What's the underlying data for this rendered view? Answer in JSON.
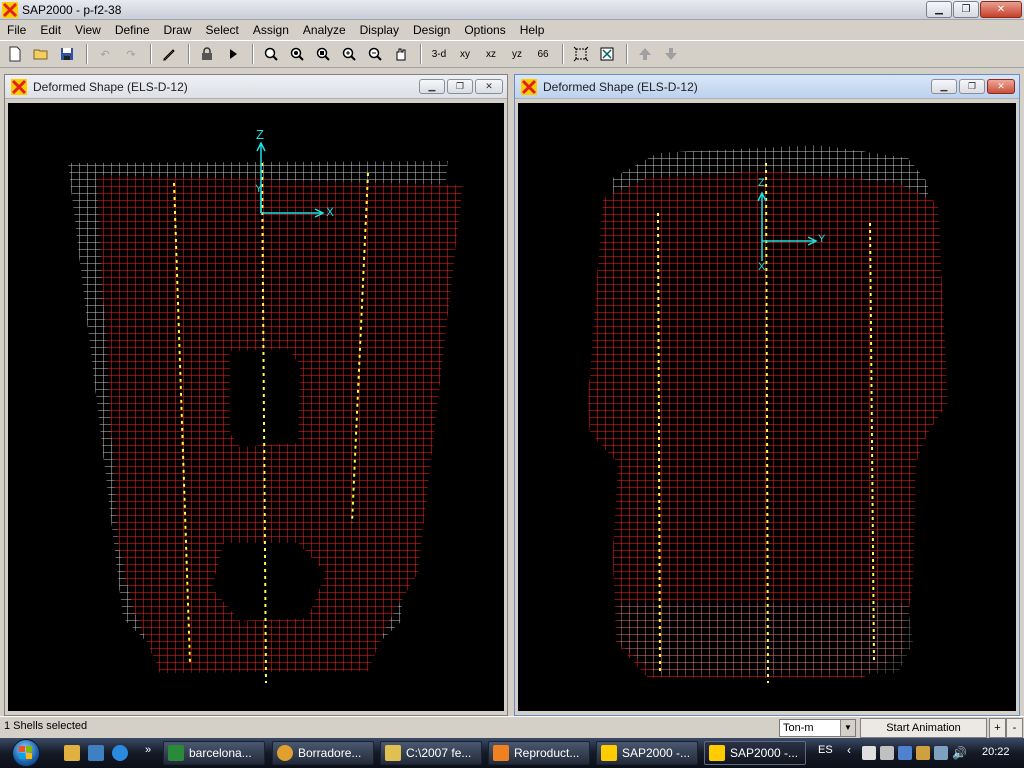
{
  "app": {
    "title": "SAP2000 - p-f2-38"
  },
  "menu": [
    "File",
    "Edit",
    "View",
    "Define",
    "Draw",
    "Select",
    "Assign",
    "Analyze",
    "Display",
    "Design",
    "Options",
    "Help"
  ],
  "toolbar": {
    "view_3d": "3-d",
    "view_xy": "xy",
    "view_xz": "xz",
    "view_yz": "yz",
    "rubber_band": "66"
  },
  "windows": {
    "left_title": "Deformed Shape (ELS-D-12)",
    "right_title": "Deformed Shape (ELS-D-12)",
    "left_axes": {
      "z": "Z",
      "y": "Y",
      "x": "X"
    },
    "right_axes": {
      "z": "Z",
      "y": "Y",
      "x": "X"
    }
  },
  "status": {
    "selection": "1 Shells selected",
    "units": "Ton-m",
    "animation": "Start Animation",
    "step_plus": "+",
    "step_minus": "-"
  },
  "taskbar": {
    "more": "»",
    "items": [
      "barcelona...",
      "Borradore...",
      "C:\\2007 fe...",
      "Reproduct...",
      "SAP2000 -...",
      "SAP2000 -..."
    ],
    "language": "ES",
    "clock": "20:22"
  },
  "colors": {
    "mesh_red": "#ff2020",
    "mesh_white": "#c8c8c8",
    "mesh_yellow": "#ffff40",
    "axes_cyan": "#20e0e0"
  }
}
